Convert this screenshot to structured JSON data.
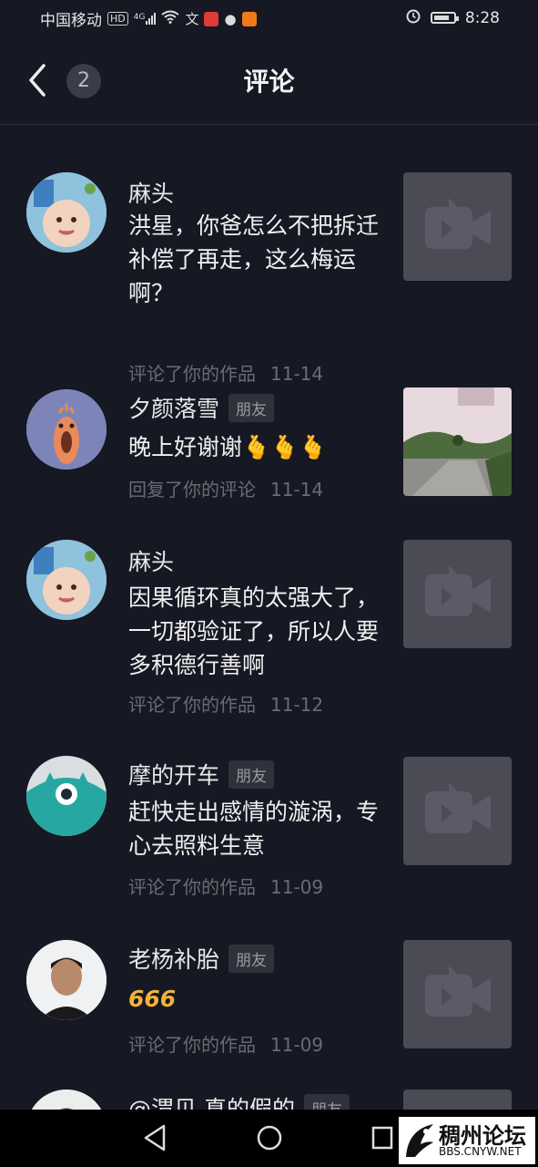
{
  "status": {
    "carrier": "中国移动",
    "hd": "HD",
    "network": "4G",
    "time": "8:28"
  },
  "header": {
    "title": "评论",
    "unread_count": "2",
    "back_icon": "chevron-left-icon"
  },
  "comments": [
    {
      "name": "麻头",
      "friend": false,
      "text": "洪星，你爸怎么不把拆迁补偿了再走，这么梅运啊？",
      "action": "评论了你的作品",
      "date": "11-14",
      "thumb": "video-placeholder"
    },
    {
      "name": "夕颜落雪",
      "friend": true,
      "friend_label": "朋友",
      "text": "晚上好谢谢🫰🫰🫰",
      "action": "回复了你的评论",
      "date": "11-14",
      "thumb": "landscape-photo"
    },
    {
      "name": "麻头",
      "friend": false,
      "text": "因果循环真的太强大了，一切都验证了，所以人要多积德行善啊",
      "action": "评论了你的作品",
      "date": "11-12",
      "thumb": "video-placeholder"
    },
    {
      "name": "摩的开车",
      "friend": true,
      "friend_label": "朋友",
      "text": "赶快走出感情的漩涡，专心去照料生意",
      "action": "评论了你的作品",
      "date": "11-09",
      "thumb": "video-placeholder"
    },
    {
      "name": "老杨补胎",
      "friend": true,
      "friend_label": "朋友",
      "text": "666",
      "action": "评论了你的作品",
      "date": "11-09",
      "thumb": "video-placeholder"
    },
    {
      "name": "@渭贝 真的假的",
      "friend": true,
      "friend_label": "朋友",
      "text": "",
      "action": "",
      "date": "",
      "thumb": "video-placeholder"
    }
  ],
  "watermark": {
    "title": "稠州论坛",
    "url": "BBS.CNYW.NET"
  },
  "colors": {
    "background": "#161823",
    "text": "#f0f0f0",
    "meta": "#6a6b73",
    "badge_bg": "#2f313b",
    "thumb_bg": "#4a4b55"
  }
}
